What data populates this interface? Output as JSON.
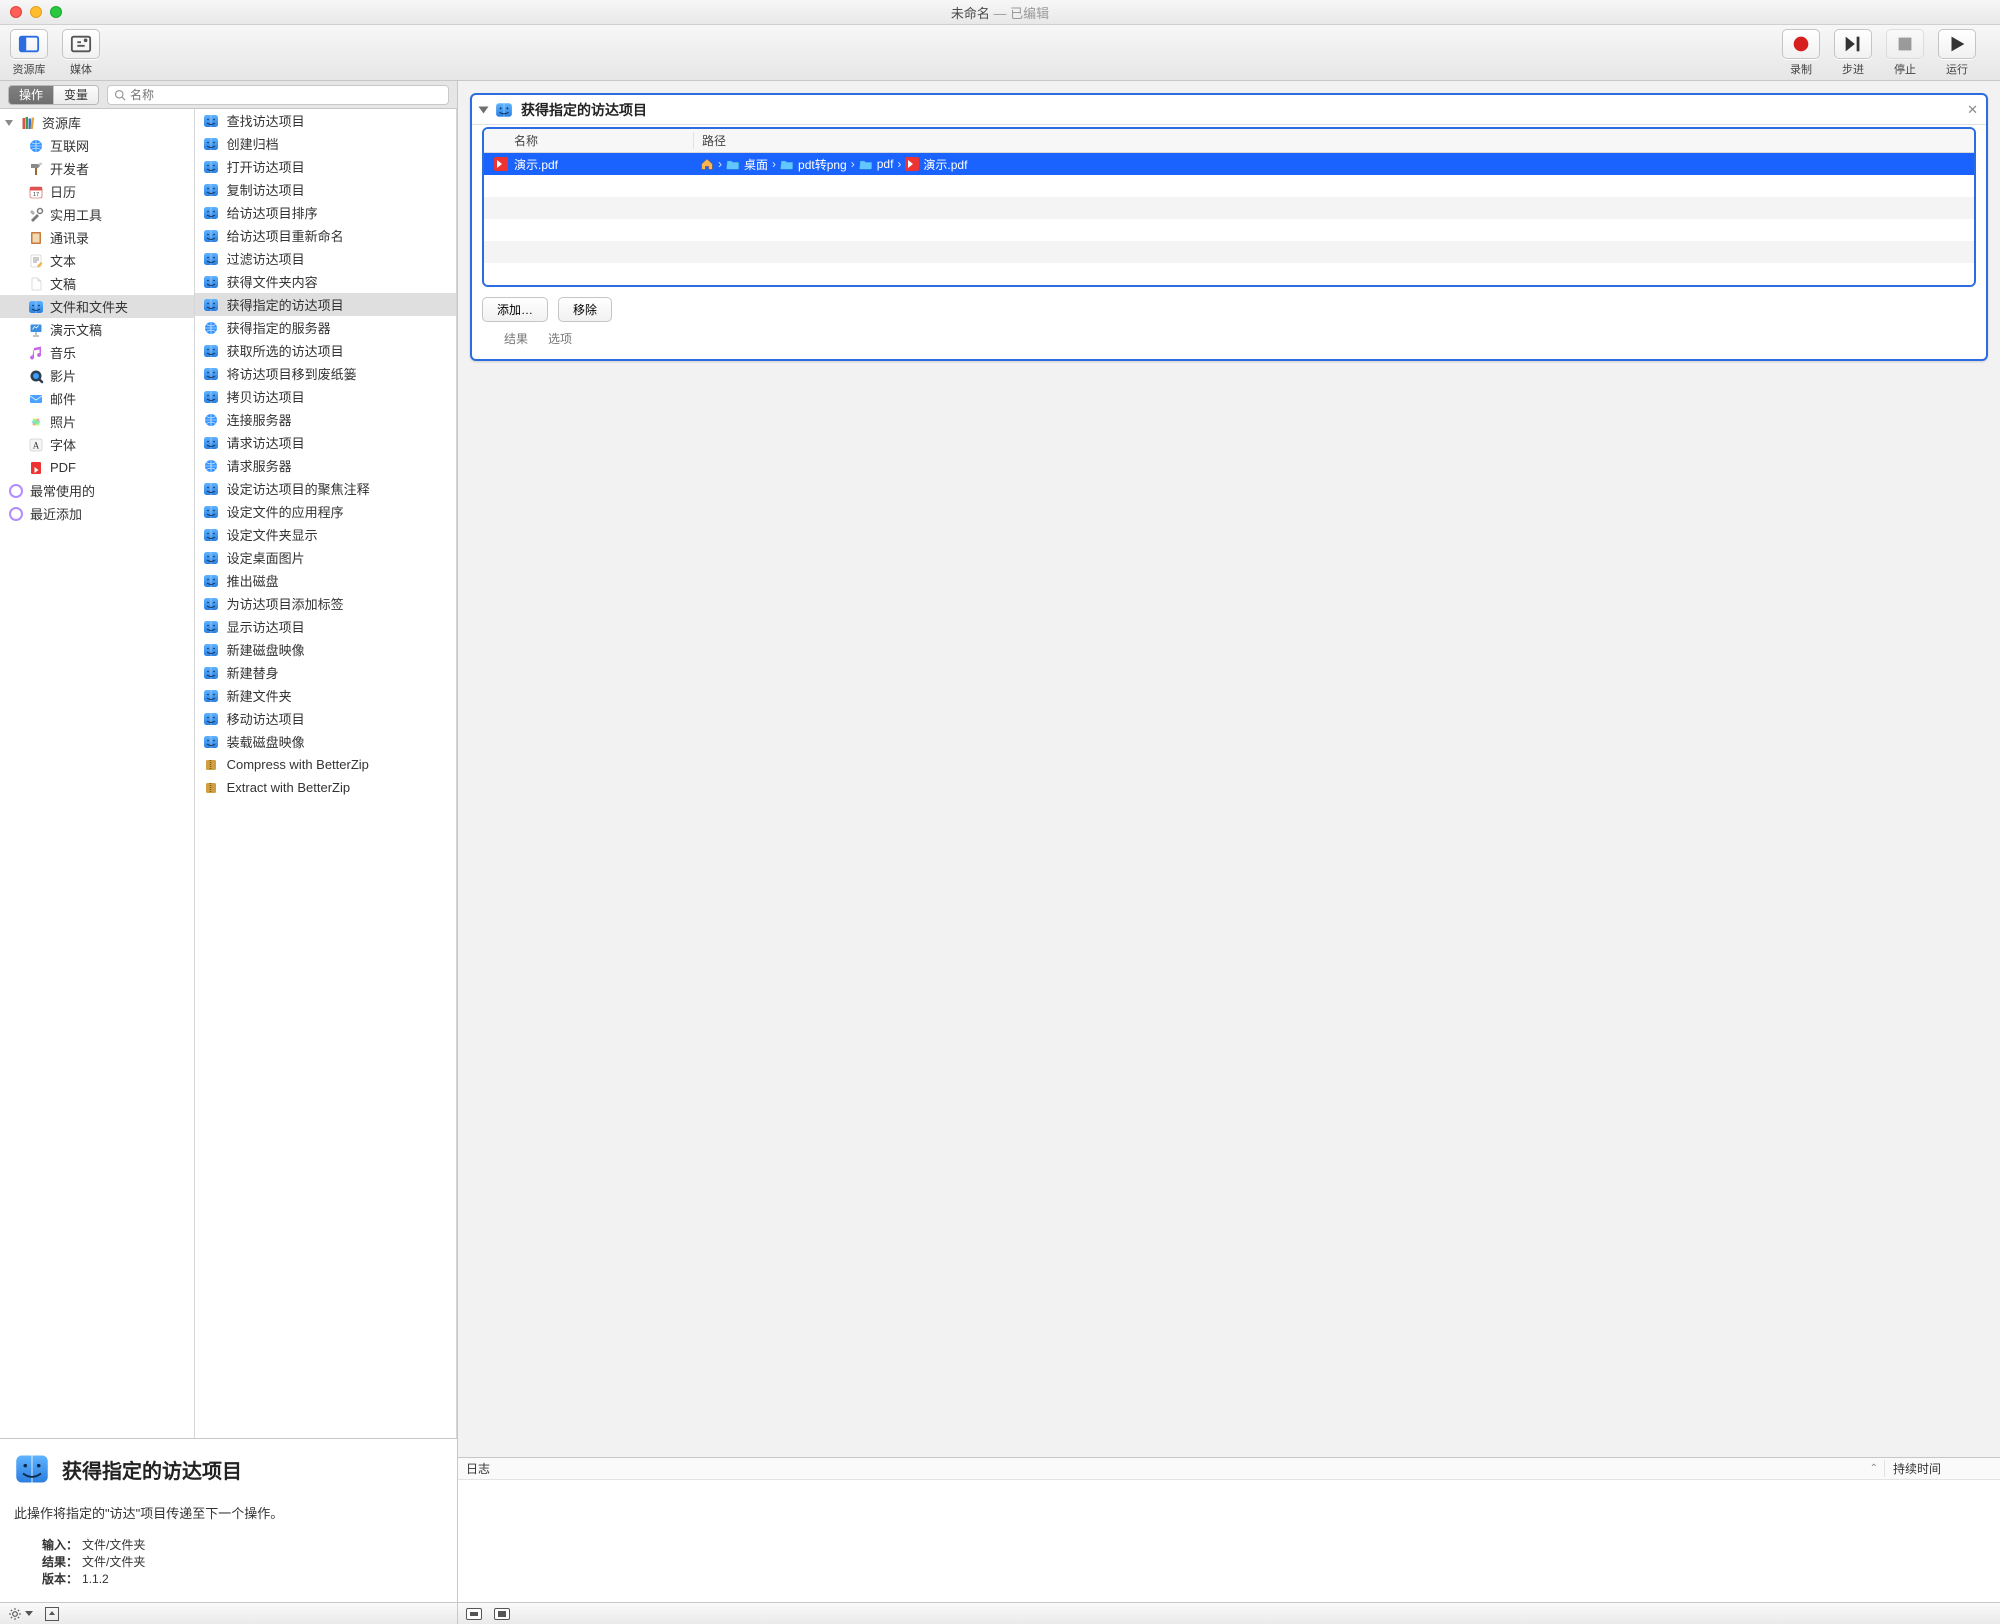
{
  "window": {
    "title": "未命名",
    "edited": "— 已编辑"
  },
  "toolbar": {
    "library": "资源库",
    "media": "媒体",
    "record": "录制",
    "step": "步进",
    "stop": "停止",
    "run": "运行"
  },
  "filter": {
    "tab_actions": "操作",
    "tab_variables": "变量",
    "search_placeholder": "名称"
  },
  "sidebar": {
    "library_header": "资源库",
    "items": [
      {
        "label": "互联网"
      },
      {
        "label": "开发者"
      },
      {
        "label": "日历"
      },
      {
        "label": "实用工具"
      },
      {
        "label": "通讯录"
      },
      {
        "label": "文本"
      },
      {
        "label": "文稿"
      },
      {
        "label": "文件和文件夹",
        "selected": true
      },
      {
        "label": "演示文稿"
      },
      {
        "label": "音乐"
      },
      {
        "label": "影片"
      },
      {
        "label": "邮件"
      },
      {
        "label": "照片"
      },
      {
        "label": "字体"
      },
      {
        "label": "PDF"
      }
    ],
    "most_used": "最常使用的",
    "recent": "最近添加"
  },
  "actions": [
    {
      "label": "查找访达项目"
    },
    {
      "label": "创建归档"
    },
    {
      "label": "打开访达项目"
    },
    {
      "label": "复制访达项目"
    },
    {
      "label": "给访达项目排序"
    },
    {
      "label": "给访达项目重新命名"
    },
    {
      "label": "过滤访达项目"
    },
    {
      "label": "获得文件夹内容"
    },
    {
      "label": "获得指定的访达项目",
      "selected": true
    },
    {
      "label": "获得指定的服务器"
    },
    {
      "label": "获取所选的访达项目"
    },
    {
      "label": "将访达项目移到废纸篓"
    },
    {
      "label": "拷贝访达项目"
    },
    {
      "label": "连接服务器"
    },
    {
      "label": "请求访达项目"
    },
    {
      "label": "请求服务器"
    },
    {
      "label": "设定访达项目的聚焦注释"
    },
    {
      "label": "设定文件的应用程序"
    },
    {
      "label": "设定文件夹显示"
    },
    {
      "label": "设定桌面图片"
    },
    {
      "label": "推出磁盘"
    },
    {
      "label": "为访达项目添加标签"
    },
    {
      "label": "显示访达项目"
    },
    {
      "label": "新建磁盘映像"
    },
    {
      "label": "新建替身"
    },
    {
      "label": "新建文件夹"
    },
    {
      "label": "移动访达项目"
    },
    {
      "label": "装载磁盘映像"
    },
    {
      "label": "Compress with BetterZip"
    },
    {
      "label": "Extract with BetterZip"
    }
  ],
  "card": {
    "title": "获得指定的访达项目",
    "col_name": "名称",
    "col_path": "路径",
    "file": "演示.pdf",
    "path": [
      "桌面",
      "pdt转png",
      "pdf",
      "演示.pdf"
    ],
    "btn_add": "添加…",
    "btn_remove": "移除",
    "tab_result": "结果",
    "tab_options": "选项"
  },
  "log": {
    "header": "日志",
    "duration": "持续时间"
  },
  "description": {
    "title": "获得指定的访达项目",
    "text": "此操作将指定的\"访达\"项目传递至下一个操作。",
    "input_label": "输入：",
    "input_value": "文件/文件夹",
    "result_label": "结果：",
    "result_value": "文件/文件夹",
    "version_label": "版本：",
    "version_value": "1.1.2"
  }
}
